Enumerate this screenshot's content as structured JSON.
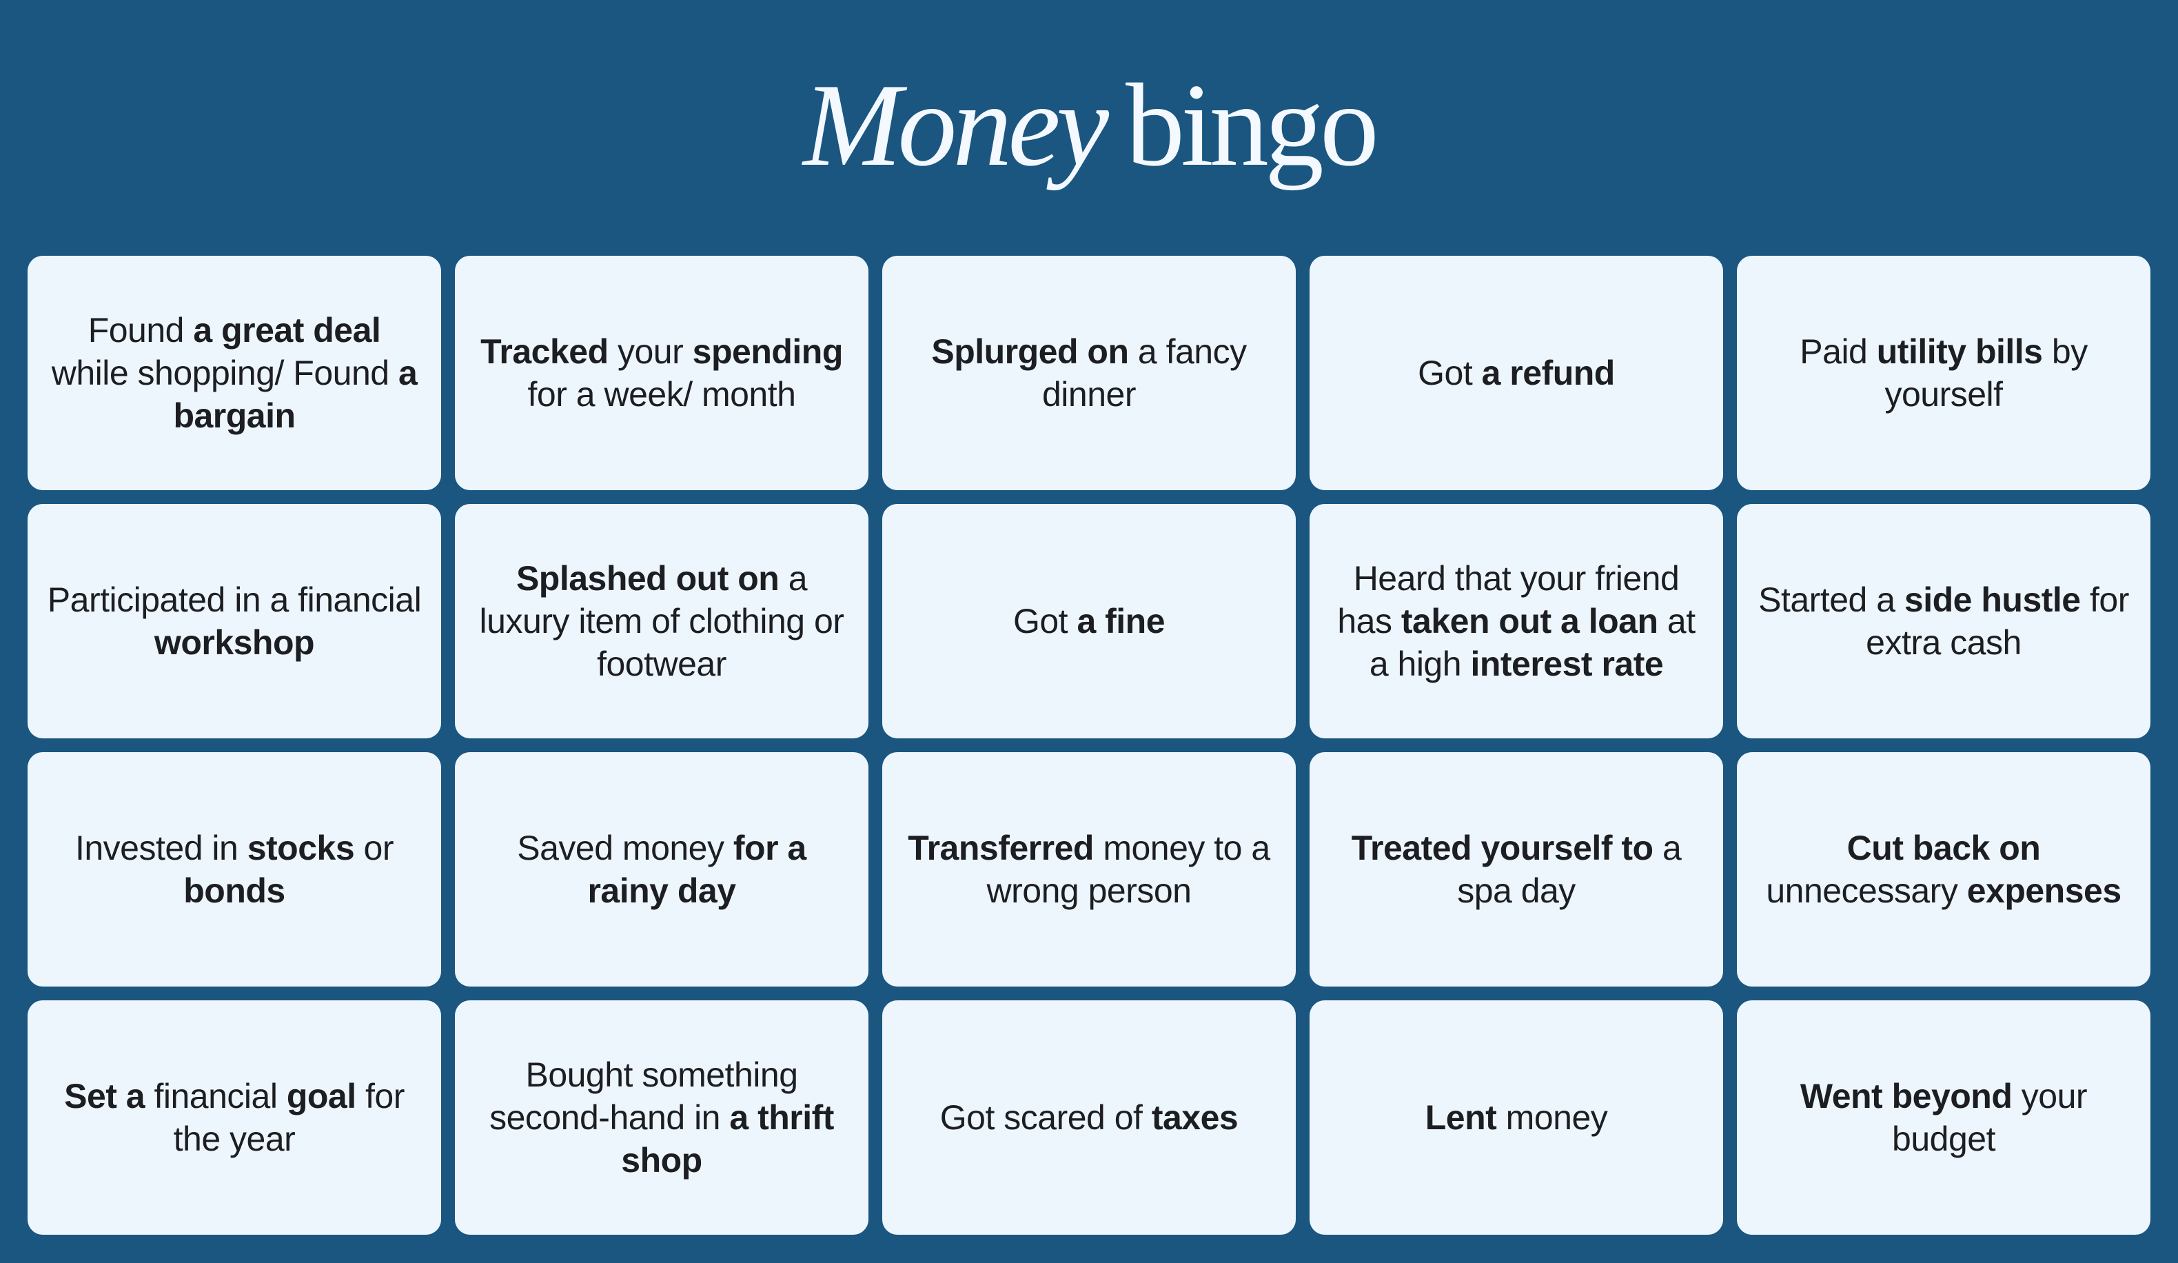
{
  "title": {
    "italic": "Money",
    "regular": "bingo"
  },
  "cells": [
    [
      {
        "t": "Found ",
        "b": false
      },
      {
        "t": "a great deal",
        "b": true
      },
      {
        "t": " while shopping/ Found ",
        "b": false
      },
      {
        "t": "a bargain",
        "b": true
      }
    ],
    [
      {
        "t": "Tracked",
        "b": true
      },
      {
        "t": " your ",
        "b": false
      },
      {
        "t": "spending",
        "b": true
      },
      {
        "t": " for a week/ month",
        "b": false
      }
    ],
    [
      {
        "t": "Splurged on",
        "b": true
      },
      {
        "t": " a fancy dinner",
        "b": false
      }
    ],
    [
      {
        "t": "Got ",
        "b": false
      },
      {
        "t": "a refund",
        "b": true
      }
    ],
    [
      {
        "t": "Paid ",
        "b": false
      },
      {
        "t": "utility bills",
        "b": true
      },
      {
        "t": " by yourself",
        "b": false
      }
    ],
    [
      {
        "t": "Participated in a financial ",
        "b": false
      },
      {
        "t": "workshop",
        "b": true
      }
    ],
    [
      {
        "t": "Splashed out on",
        "b": true
      },
      {
        "t": " a luxury item of clothing or footwear",
        "b": false
      }
    ],
    [
      {
        "t": "Got ",
        "b": false
      },
      {
        "t": "a fine",
        "b": true
      }
    ],
    [
      {
        "t": "Heard that your friend has ",
        "b": false
      },
      {
        "t": "taken out a loan",
        "b": true
      },
      {
        "t": " at a high ",
        "b": false
      },
      {
        "t": "interest rate",
        "b": true
      }
    ],
    [
      {
        "t": "Started a ",
        "b": false
      },
      {
        "t": "side hustle",
        "b": true
      },
      {
        "t": " for extra cash",
        "b": false
      }
    ],
    [
      {
        "t": "Invested in ",
        "b": false
      },
      {
        "t": "stocks",
        "b": true
      },
      {
        "t": " or ",
        "b": false
      },
      {
        "t": "bonds",
        "b": true
      }
    ],
    [
      {
        "t": "Saved money ",
        "b": false
      },
      {
        "t": "for a rainy day",
        "b": true
      }
    ],
    [
      {
        "t": "Transferred",
        "b": true
      },
      {
        "t": " money to a wrong person",
        "b": false
      }
    ],
    [
      {
        "t": "Treated yourself to",
        "b": true
      },
      {
        "t": " a spa day",
        "b": false
      }
    ],
    [
      {
        "t": "Cut back on",
        "b": true
      },
      {
        "t": " unnecessary ",
        "b": false
      },
      {
        "t": "expenses",
        "b": true
      }
    ],
    [
      {
        "t": "Set a",
        "b": true
      },
      {
        "t": " financial ",
        "b": false
      },
      {
        "t": "goal",
        "b": true
      },
      {
        "t": " for the year",
        "b": false
      }
    ],
    [
      {
        "t": "Bought something second-hand in ",
        "b": false
      },
      {
        "t": "a thrift shop",
        "b": true
      }
    ],
    [
      {
        "t": "Got scared of ",
        "b": false
      },
      {
        "t": "taxes",
        "b": true
      }
    ],
    [
      {
        "t": "Lent",
        "b": true
      },
      {
        "t": " money",
        "b": false
      }
    ],
    [
      {
        "t": "Went beyond",
        "b": true
      },
      {
        "t": " your budget",
        "b": false
      }
    ]
  ]
}
